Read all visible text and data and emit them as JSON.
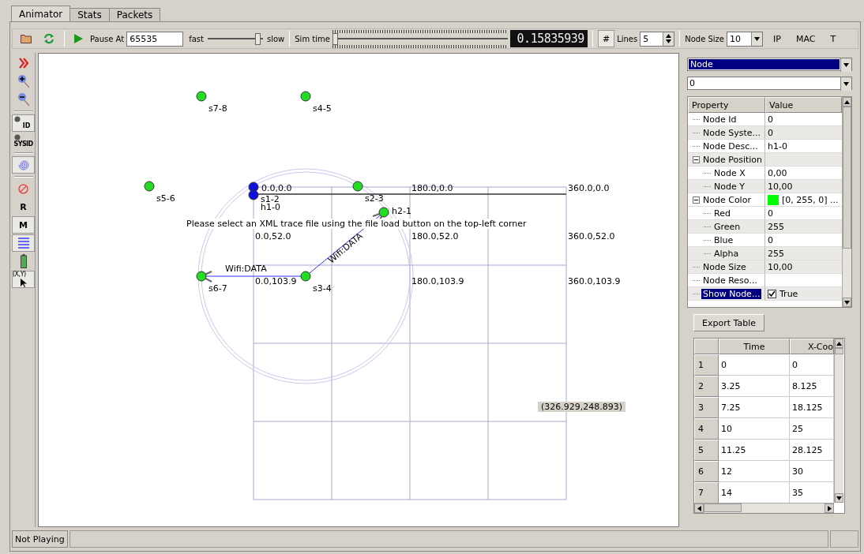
{
  "tabs": [
    {
      "label": "Animator",
      "selected": true
    },
    {
      "label": "Stats",
      "selected": false
    },
    {
      "label": "Packets",
      "selected": false
    }
  ],
  "toolbar": {
    "pause_at_label": "Pause At",
    "pause_at_value": "65535",
    "fast_label": "fast",
    "speed": {
      "level": 0.9
    },
    "slow_label": "slow",
    "sim_time_label": "Sim time",
    "sim_time": {
      "level": 0.0
    },
    "sim_time_display": "0.15835939",
    "grid_toggle": {
      "label": "#",
      "checked": true
    },
    "lines_label": "Lines",
    "lines_value": "5",
    "node_size_label": "Node Size",
    "node_size_value": "10",
    "buttons": [
      "IP",
      "MAC",
      "T"
    ]
  },
  "left_tools": [
    {
      "kind": "chevrons",
      "checked": false
    },
    {
      "kind": "zoomin",
      "checked": false
    },
    {
      "kind": "zoomout",
      "checked": false
    },
    {
      "kind": "separator"
    },
    {
      "kind": "nodeid",
      "label": "ID",
      "checked": true
    },
    {
      "kind": "sysid",
      "label": "SYSID",
      "checked": false
    },
    {
      "kind": "separator"
    },
    {
      "kind": "spiral",
      "checked": true
    },
    {
      "kind": "separator"
    },
    {
      "kind": "noentry",
      "checked": false
    },
    {
      "kind": "text",
      "label": "R",
      "checked": false
    },
    {
      "kind": "text",
      "label": "M",
      "checked": true
    },
    {
      "kind": "lines",
      "checked": true
    },
    {
      "kind": "battery",
      "checked": false
    },
    {
      "kind": "cursor",
      "label": "(X,Y)",
      "checked": true
    }
  ],
  "canvas": {
    "grid_labels": [
      "0.0,0.0",
      "180.0,0.0",
      "360.0,0.0",
      "0.0,52.0",
      "180.0,52.0",
      "360.0,52.0",
      "0.0,103.9",
      "180.0,103.9",
      "360.0,103.9"
    ],
    "nodes": [
      {
        "label": "s7-8",
        "color": "#22dd22"
      },
      {
        "label": "s4-5",
        "color": "#22dd22"
      },
      {
        "label": "s5-6",
        "color": "#22dd22"
      },
      {
        "label": "s1-2",
        "color": "#1010dd"
      },
      {
        "label": "h1-0",
        "color": "#1010dd"
      },
      {
        "label": "s2-3",
        "color": "#22dd22"
      },
      {
        "label": "h2-1",
        "color": "#22dd22"
      },
      {
        "label": "s6-7",
        "color": "#22dd22"
      },
      {
        "label": "s3-4",
        "color": "#22dd22"
      }
    ],
    "message": "Please select an XML trace file using the file load button on the top-left corner",
    "links": [
      {
        "label": "Wifi:DATA"
      },
      {
        "label": "Wifi:DATA"
      }
    ],
    "mouse_position": "(326.929,248.893)"
  },
  "side": {
    "type_select": "Node",
    "id_select": "0",
    "property_columns": [
      "Property",
      "Value"
    ],
    "properties": [
      {
        "name": "Node Id",
        "value": "0",
        "selected": false
      },
      {
        "name": "Node Syste...",
        "value": "0",
        "selected": false
      },
      {
        "name": "Node Desc...",
        "value": "h1-0",
        "selected": false
      },
      {
        "name": "Node Position",
        "expanded": true,
        "selected": false,
        "children": [
          {
            "name": "Node X",
            "value": "0,00",
            "selected": false
          },
          {
            "name": "Node Y",
            "value": "10,00",
            "selected": false
          }
        ]
      },
      {
        "name": "Node Color",
        "value": "[0, 255, 0] ...",
        "color": "#00ff00",
        "expanded": true,
        "selected": false,
        "children": [
          {
            "name": "Red",
            "value": "0",
            "selected": false
          },
          {
            "name": "Green",
            "value": "255",
            "selected": false
          },
          {
            "name": "Blue",
            "value": "0",
            "selected": false
          },
          {
            "name": "Alpha",
            "value": "255",
            "selected": false
          }
        ]
      },
      {
        "name": "Node Size",
        "value": "10,00",
        "selected": false
      },
      {
        "name": "Node Reso...",
        "selected": false
      },
      {
        "name": "Show Node...",
        "value": "True",
        "checked": true,
        "selected": true
      }
    ],
    "export_button": "Export Table",
    "table_columns": [
      "Time",
      "X-Coo"
    ],
    "table_rows": [
      {
        "header": "1",
        "cells": [
          "0",
          "0"
        ]
      },
      {
        "header": "2",
        "cells": [
          "3.25",
          "8.125"
        ]
      },
      {
        "header": "3",
        "cells": [
          "7.25",
          "18.125"
        ]
      },
      {
        "header": "4",
        "cells": [
          "10",
          "25"
        ]
      },
      {
        "header": "5",
        "cells": [
          "11.25",
          "28.125"
        ]
      },
      {
        "header": "6",
        "cells": [
          "12",
          "30"
        ]
      },
      {
        "header": "7",
        "cells": [
          "14",
          "35"
        ]
      }
    ]
  },
  "status_bar": {
    "text": "Not Playing"
  }
}
